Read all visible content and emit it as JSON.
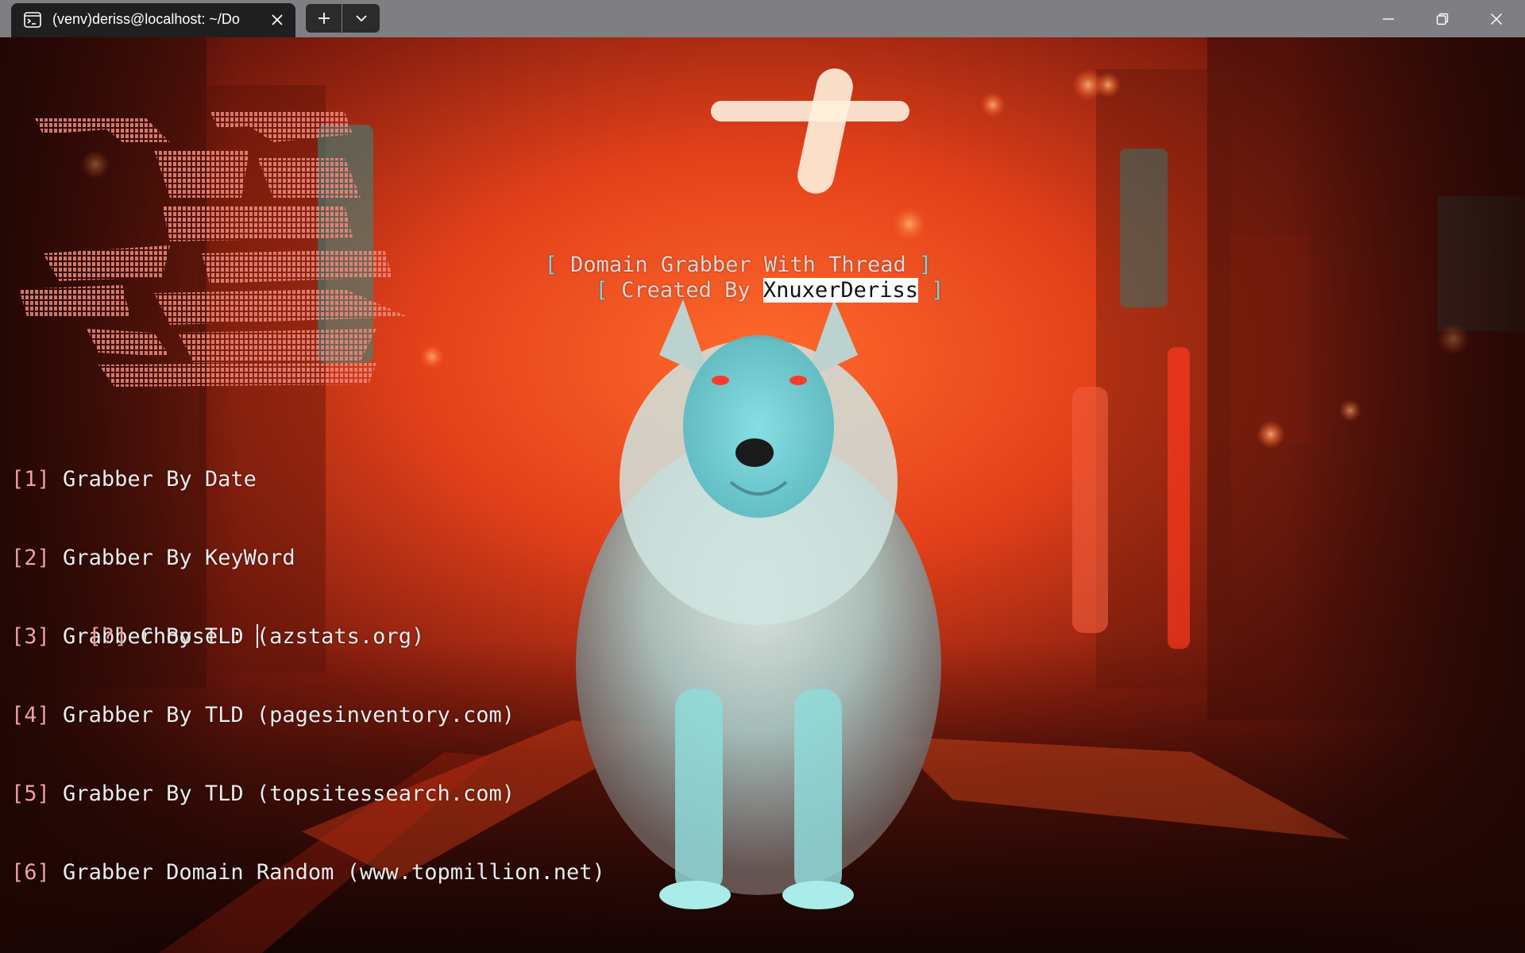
{
  "window": {
    "tab_title": "(venv)deriss@localhost: ~/Do",
    "tab_icon": "terminal-icon",
    "new_tab_icon": "plus-icon",
    "dropdown_icon": "chevron-down-icon",
    "controls": [
      "minimize-icon",
      "restore-icon",
      "close-icon"
    ]
  },
  "banner": {
    "open_bracket": "[",
    "close_bracket": "]",
    "line1": " Domain Grabber With Thread ",
    "line2_prefix": " Created By ",
    "author": "XnuxerDeriss",
    "line2_suffix": " "
  },
  "menu": {
    "items": [
      {
        "num": "1",
        "label": " Grabber By Date"
      },
      {
        "num": "2",
        "label": " Grabber By KeyWord"
      },
      {
        "num": "3",
        "label": " Grabber By TLD (azstats.org)"
      },
      {
        "num": "4",
        "label": " Grabber By TLD (pagesinventory.com)"
      },
      {
        "num": "5",
        "label": " Grabber By TLD (topsitessearch.com)"
      },
      {
        "num": "6",
        "label": " Grabber Domain Random (www.topmillion.net)"
      }
    ]
  },
  "prompt": {
    "marker": "?",
    "label": " Choose : "
  },
  "colors": {
    "titlebar": "#7f7f83",
    "tab": "#1f1f1f",
    "banner_bracket": "#7fd3de",
    "menu_bracket": "#f0a0a0",
    "ascii_art": "#ee8a80"
  },
  "background": "wolf in neon-red city street wallpaper"
}
